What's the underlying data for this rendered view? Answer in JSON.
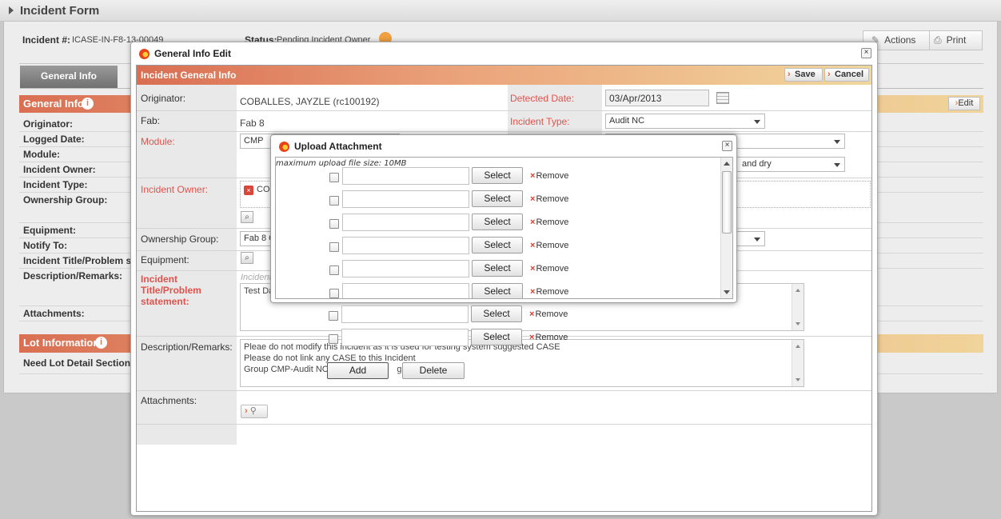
{
  "page": {
    "title": "Incident Form",
    "incident_label": "Incident #:",
    "incident_value": "ICASE-IN-F8-13-00049",
    "status_label": "Status:",
    "status_value": "Pending Incident Owner",
    "actions_label": "Actions",
    "print_label": "Print",
    "tab_general": "General Info",
    "section_general": "General Info",
    "edit_label": "Edit",
    "rows": [
      "Originator:",
      "Logged Date:",
      "Module:",
      "Incident Owner:",
      "Incident Type:",
      "Ownership Group:",
      "Equipment:",
      "Notify To:",
      "Incident Title/Problem st",
      "Description/Remarks:",
      "Attachments:"
    ],
    "section_lot": "Lot Information",
    "lot_question": "Need Lot Detail Section?"
  },
  "edit_dialog": {
    "title": "General Info Edit",
    "section_title": "Incident General Info",
    "save_label": "Save",
    "cancel_label": "Cancel",
    "originator_label": "Originator:",
    "originator_value": "COBALLES, JAYZLE (rc100192)",
    "detected_date_label": "Detected Date:",
    "detected_date_value": "03/Apr/2013",
    "fab_label": "Fab:",
    "fab_value": "Fab 8",
    "incident_type_label": "Incident Type:",
    "incident_type_value": "Audit NC",
    "module_label": "Module:",
    "module_value": "CMP",
    "partial_select_text": "and dry",
    "incident_owner_label": "Incident Owner:",
    "incident_owner_chip": "COE",
    "ownership_group_label": "Ownership Group:",
    "ownership_group_value": "Fab 8 C",
    "equipment_label": "Equipment:",
    "incident_title_label": "Incident Title/Problem statement:",
    "incident_title_hint": "Incident",
    "incident_title_value": "Test Da",
    "description_label": "Description/Remarks:",
    "description_lines": [
      "Pleae do not modify this incident as it is used for testing system suggested CASE",
      "Please do not link any CASE to this Incident",
      "Group CMP-Audit NC-"
    ],
    "description_tail": "g &",
    "attachments_label": "Attachments:",
    "add_label": "Add",
    "delete_label": "Delete"
  },
  "upload_dialog": {
    "title": "Upload Attachment",
    "hint": "maximum upload file size: 10MB",
    "select_label": "Select",
    "remove_label": "Remove",
    "row_count": 8
  }
}
